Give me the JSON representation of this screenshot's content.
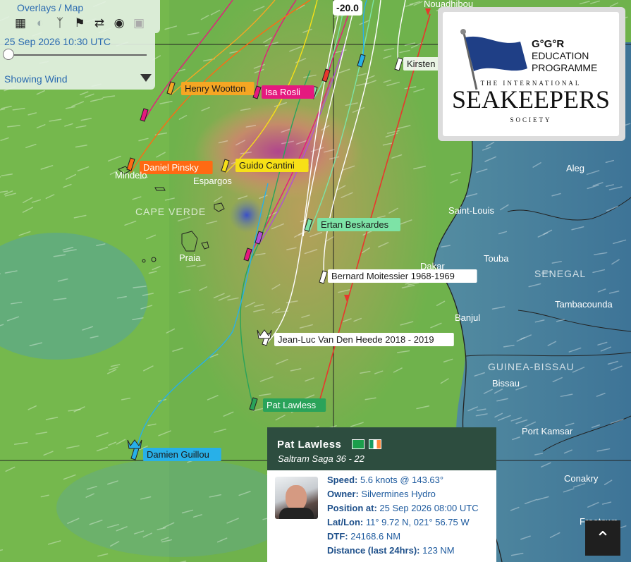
{
  "controls": {
    "title": "Overlays / Map",
    "date": "25 Sep 2026 10:30 UTC",
    "showing": "Showing Wind",
    "icons": [
      "grid-icon",
      "moon-icon",
      "route-icon",
      "flags-icon",
      "shuffle-icon",
      "globe-icon",
      "layers-icon"
    ]
  },
  "map": {
    "scale_value": "-20.0",
    "places": [
      "Nouadhibou",
      "Mindelo",
      "Espargos",
      "Praia",
      "Aleg",
      "Saint-Louis",
      "Dakar",
      "Touba",
      "Banjul",
      "Tambacounda",
      "Bissau",
      "Port Kamsar",
      "Conakry",
      "Freetown"
    ],
    "countries": [
      "CAPE VERDE",
      "SENEGAL",
      "GUINEA-BISSAU"
    ],
    "boats": [
      {
        "name": "Henry Wootton",
        "color": "#f5a623"
      },
      {
        "name": "Isa Rosli",
        "color": "#e5197f"
      },
      {
        "name": "Kirsten N",
        "color": "#ffffff"
      },
      {
        "name": "Daniel Pinsky",
        "color": "#ff6a13"
      },
      {
        "name": "Guido Cantini",
        "color": "#f7e017"
      },
      {
        "name": "Ertan Beskardes",
        "color": "#7de3a6"
      },
      {
        "name": "Bernard Moitessier 1968-1969",
        "color": "#ffffff"
      },
      {
        "name": "Jean-Luc Van Den Heede 2018 - 2019",
        "color": "#ffffff"
      },
      {
        "name": "Pat Lawless",
        "color": "#2aa35a"
      },
      {
        "name": "Damien Guillou",
        "color": "#28b0e8"
      }
    ]
  },
  "logo": {
    "line1": "G°G°R",
    "line2": "EDUCATION",
    "line3": "PROGRAMME",
    "line4": "THE INTERNATIONAL",
    "line5": "SEAKEEPERS",
    "line6": "SOCIETY"
  },
  "infobox": {
    "name": "Pat Lawless",
    "boat": "Saltram Saga 36 - 22",
    "rows": [
      {
        "k": "Speed:",
        "v": "5.6 knots @ 143.63°"
      },
      {
        "k": "Owner:",
        "v": "Silvermines Hydro"
      },
      {
        "k": "Position at:",
        "v": "25 Sep 2026 08:00 UTC"
      },
      {
        "k": "Lat/Lon:",
        "v": "11° 9.72 N, 021° 56.75 W"
      },
      {
        "k": "DTF:",
        "v": "24168.6 NM"
      },
      {
        "k": "Distance (last 24hrs):",
        "v": "123 NM"
      }
    ]
  },
  "colors": {
    "panel": "#2d4d3f",
    "link": "#1d5a9e",
    "sea_green": "#4fa64a"
  }
}
